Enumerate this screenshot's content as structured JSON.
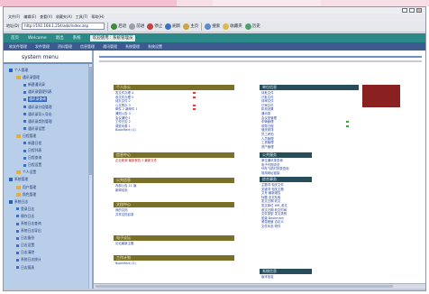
{
  "browser": {
    "menu": [
      "文件(F)",
      "编辑(E)",
      "查看(V)",
      "收藏夹(A)",
      "工具(T)",
      "帮助(H)"
    ],
    "address_label": "地址(D)",
    "address": "http://192.168.1.254/ado/index.asp",
    "toolbar": [
      "后退",
      "前进",
      "停止",
      "刷新",
      "主页",
      "搜索",
      "收藏夹",
      "历史"
    ]
  },
  "app_nav": {
    "items": [
      "首页",
      "Welcome",
      "退出",
      "系统"
    ],
    "user": "欢迎使用 : 系统管理员"
  },
  "app_subnav": {
    "items": [
      "收发件管理",
      "发件管理",
      "资料管理",
      "信息管理",
      "通讯管理",
      "系统管理",
      "系统设置"
    ]
  },
  "sidebar": {
    "title": "system menu",
    "tree": [
      {
        "label": "个人管理",
        "level": 0,
        "kind": "box"
      },
      {
        "label": "通讯录管理",
        "level": 1,
        "kind": "folder"
      },
      {
        "label": "新建通讯录",
        "level": 2,
        "kind": "leaf"
      },
      {
        "label": "通讯录管理列表",
        "level": 2,
        "kind": "leaf"
      },
      {
        "label": "通讯录查询",
        "level": 2,
        "kind": "leaf",
        "selected": true
      },
      {
        "label": "通讯录分组管理",
        "level": 2,
        "kind": "leaf"
      },
      {
        "label": "通讯录导入导出",
        "level": 2,
        "kind": "leaf"
      },
      {
        "label": "通讯录类别管理",
        "level": 2,
        "kind": "leaf"
      },
      {
        "label": "通讯录设置",
        "level": 2,
        "kind": "leaf"
      },
      {
        "label": "日程管理",
        "level": 1,
        "kind": "folder"
      },
      {
        "label": "新建日程",
        "level": 2,
        "kind": "leaf"
      },
      {
        "label": "日程列表",
        "level": 2,
        "kind": "leaf"
      },
      {
        "label": "日程查询",
        "level": 2,
        "kind": "leaf"
      },
      {
        "label": "日程设置",
        "level": 2,
        "kind": "leaf"
      },
      {
        "label": "个人设置",
        "level": 1,
        "kind": "folder"
      },
      {
        "label": "系统管理",
        "level": 0,
        "kind": "box"
      },
      {
        "label": "用户管理",
        "level": 1,
        "kind": "folder"
      },
      {
        "label": "角色管理",
        "level": 1,
        "kind": "folder"
      },
      {
        "label": "系统日志",
        "level": 0,
        "kind": "box"
      },
      {
        "label": "登录日志",
        "level": 1,
        "kind": "leaf"
      },
      {
        "label": "操作日志",
        "level": 1,
        "kind": "leaf"
      },
      {
        "label": "系统日志查询",
        "level": 1,
        "kind": "leaf"
      },
      {
        "label": "系统日志导出",
        "level": 1,
        "kind": "leaf"
      },
      {
        "label": "日志备份",
        "level": 1,
        "kind": "leaf"
      },
      {
        "label": "日志设置",
        "level": 1,
        "kind": "leaf"
      },
      {
        "label": "日志清除",
        "level": 1,
        "kind": "leaf"
      },
      {
        "label": "系统日志统计",
        "level": 1,
        "kind": "leaf"
      },
      {
        "label": "日志报表",
        "level": 1,
        "kind": "leaf"
      }
    ]
  },
  "content": {
    "sections": [
      {
        "title": "个人办公",
        "color": "olive",
        "rows": [
          "发文件办理 4",
          "收文件办理 5",
          "待办文件 2",
          "公文督办 3",
          "邮件 2 新邮件 1",
          "通知公告 3",
          "会议通知 1",
          "工作日志 2",
          "调查问卷 1",
          "BookMark (1)"
        ],
        "marks": [
          "r",
          "r",
          "",
          "r",
          "r",
          "",
          "",
          "",
          "",
          ""
        ]
      },
      {
        "title": "信息中心",
        "color": "olive",
        "rows": [
          "企业新闻 最新报告 2 最新文件"
        ]
      },
      {
        "title": "公共信息",
        "color": "olive",
        "rows": [
          "内部公告 11 版",
          "新闻动态"
        ]
      },
      {
        "title": "文档中心",
        "color": "olive",
        "rows": [
          "我的文档",
          "共享文档目录"
        ]
      },
      {
        "title": "电子论坛",
        "color": "olive",
        "rows": [
          "论坛最新主题"
        ]
      },
      {
        "title": "工作计划",
        "color": "olive",
        "rows": [
          "BookMark (2)"
        ]
      }
    ],
    "right_sections": [
      {
        "title": "单位信息",
        "color": "dark",
        "rows": [
          "待批文件",
          "已批文件",
          "待审文件",
          "已审文件",
          "机构设置",
          "通讯录",
          "会议室管理",
          "车辆管理",
          "领导日程",
          "值班安排",
          "员工考勤",
          "人员管理",
          "工资管理",
          "资产管理"
        ],
        "marks": [
          "",
          "",
          "",
          "",
          "",
          "",
          "",
          "g",
          "g",
          "",
          "",
          "",
          "",
          ""
        ]
      },
      {
        "title": "公共服务",
        "color": "dark",
        "rows": [
          "单位通讯录查询",
          "电子刊物浏览",
          "列车飞机时刻表查询",
          "常用网址链接"
        ]
      },
      {
        "title": "综合事务",
        "color": "dark",
        "rows": [
          "主题词 相关文件",
          "关键词 相关主题",
          "文号 最新报告",
          "标题 全文检索",
          "发文日期 收文",
          "发文单位 WR_收文",
          "收文日期 收文时间",
          "文件类型 发文类别",
          "密级 Bookmark",
          "紧急程度 自定义",
          "文件状态 附件"
        ]
      },
      {
        "title": "系统信息",
        "color": "dark",
        "rows": [
          "版本信息"
        ]
      }
    ]
  },
  "colors": {
    "nav_teal": "#2b8a88",
    "nav_blue": "#3c5a8f",
    "sidebar_bg": "#b9cee8",
    "olive_header": "#7a7027",
    "dark_header": "#274d5d",
    "accent_red": "#8b2020"
  }
}
